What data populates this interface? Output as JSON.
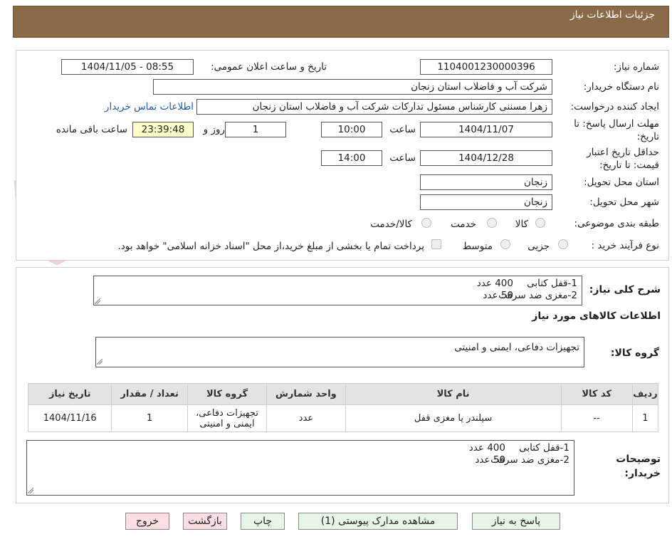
{
  "header": {
    "title": "جزئیات اطلاعات نیاز"
  },
  "watermark": {
    "text": "AriaTender.neT"
  },
  "form": {
    "need_number": {
      "label": "شماره نیاز:",
      "value": "1104001230000396"
    },
    "announce_datetime": {
      "label": "تاریخ و ساعت اعلان عمومی:",
      "value": "1404/11/05 - 08:55"
    },
    "buyer_org": {
      "label": "نام دستگاه خریدار:",
      "value": "شرکت آب و فاضلاب استان زنجان"
    },
    "requester": {
      "label": "ایجاد کننده درخواست:",
      "value": "زهرا مسننی کارشناس مسئول تدارکات شرکت آب و فاضلاب استان زنجان"
    },
    "contact_link": "اطلاعات تماس خریدار",
    "reply_deadline": {
      "label_line1": "مهلت ارسال پاسخ: تا",
      "label_line2": "تاریخ:",
      "date": "1404/11/07",
      "time_label": "ساعت",
      "time": "10:00",
      "days": "1",
      "days_label": "روز و",
      "remaining": "23:39:48",
      "remaining_label": "ساعت باقی مانده"
    },
    "price_validity": {
      "label_line1": "حداقل تاریخ اعتبار",
      "label_line2": "قیمت: تا تاریخ:",
      "date": "1404/12/28",
      "time_label": "ساعت",
      "time": "14:00"
    },
    "delivery_province": {
      "label": "استان محل تحویل:",
      "value": "زنجان"
    },
    "delivery_city": {
      "label": "شهر محل تحویل:",
      "value": "زنجان"
    },
    "category": {
      "label": "طبقه بندی موضوعی:",
      "options": [
        "کالا",
        "خدمت",
        "کالا/خدمت"
      ]
    },
    "purchase_type": {
      "label": "نوع فرآیند خرید :",
      "options": [
        "جزیی",
        "متوسط"
      ],
      "payment_note": "پرداخت تمام یا بخشی از مبلغ خرید،از محل \"اسناد خزانه اسلامی\" خواهد بود."
    }
  },
  "summary": {
    "label": "شرح کلی نیاز:",
    "lines": [
      {
        "item": "1-قفل کتابی",
        "qty": "400 عدد"
      },
      {
        "item": "2-مغزی ضد سرقت",
        "qty": "50 عدد"
      }
    ]
  },
  "goods_section": {
    "title": "اطلاعات کالاهای مورد نیاز",
    "group_label": "گروه کالا:",
    "group_value": "تجهیزات دفاعی، ایمنی و امنیتی"
  },
  "table": {
    "headers": [
      "ردیف",
      "کد کالا",
      "نام کالا",
      "واحد شمارش",
      "گروه کالا",
      "تعداد / مقدار",
      "تاریخ نیاز"
    ],
    "rows": [
      {
        "row": "1",
        "code": "--",
        "name": "سیلندر یا مغزی قفل",
        "unit": "عدد",
        "group_line1": "تجهیزات دفاعی،",
        "group_line2": "ایمنی و امنیتی",
        "qty": "1",
        "date": "1404/11/16"
      }
    ]
  },
  "buyer_notes": {
    "label_line1": "توضیحات",
    "label_line2": "خریدار:",
    "lines": [
      {
        "item": "1-قفل کتابی",
        "qty": "400 عدد"
      },
      {
        "item": "2-مغزی ضد سرقت",
        "qty": "50 عدد"
      }
    ]
  },
  "buttons": {
    "reply": "پاسخ به نیاز",
    "attachments": "مشاهده مدارک پیوستی (1)",
    "print": "چاپ",
    "back": "بازگشت",
    "exit": "خروج"
  }
}
